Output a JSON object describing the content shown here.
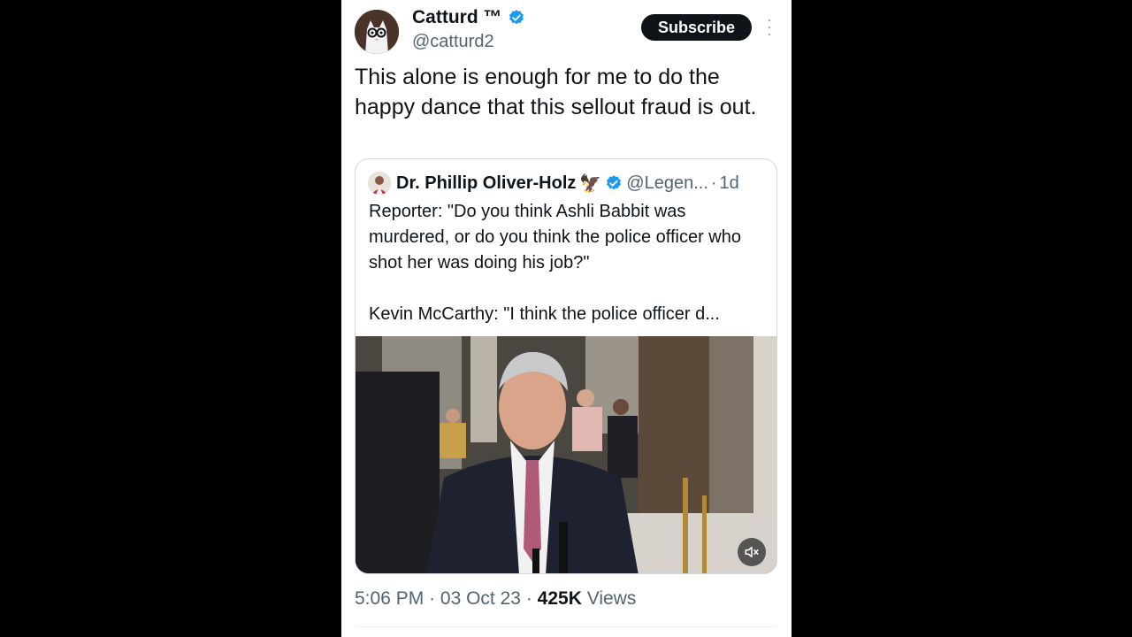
{
  "tweet": {
    "author": {
      "display_name": "Catturd ™",
      "handle": "@catturd2",
      "avatar_icon": "cat-avatar-icon"
    },
    "subscribe_label": "Subscribe",
    "more_icon": "more-vertical-icon",
    "text": "This alone is enough for me to do the happy dance that this sellout fraud is out.",
    "meta": {
      "time": "5:06 PM",
      "sep1": "·",
      "date": "03 Oct 23",
      "sep2": "·",
      "views_count": "425K",
      "views_label": "Views"
    }
  },
  "quote": {
    "author": {
      "display_name": "Dr. Phillip Oliver-Holz",
      "emoji": "🦅",
      "handle": "@Legen...",
      "dot": "·",
      "time": "1d"
    },
    "text": "Reporter: \"Do you think Ashli Babbit was murdered, or do you think the police officer who shot her was doing his job?\"\n\nKevin McCarthy: \"I think the police officer d...",
    "video": {
      "mute_icon": "volume-muted-icon"
    }
  },
  "colors": {
    "verified_blue": "#1d9bf0",
    "text_primary": "#0f1419",
    "text_secondary": "#536471",
    "border": "#cfd9de"
  }
}
